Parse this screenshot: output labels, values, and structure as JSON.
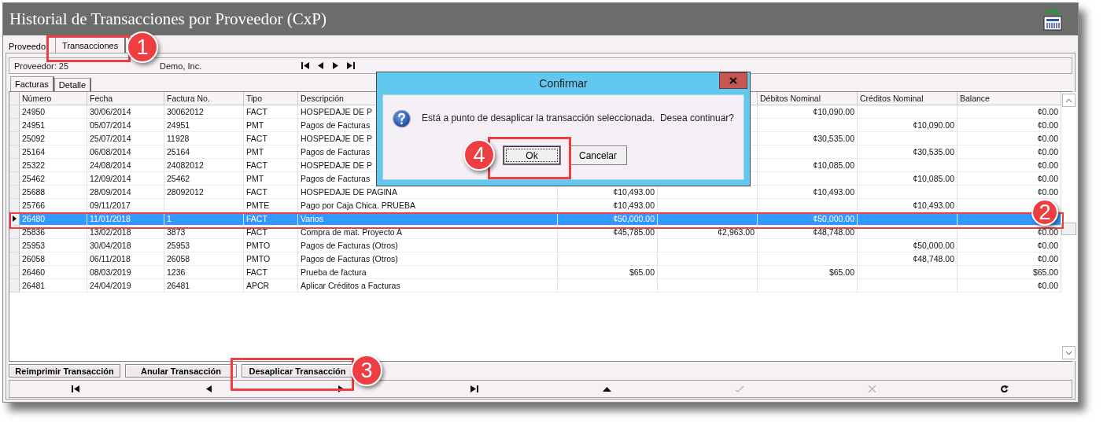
{
  "window": {
    "title": "Historial de Transacciones por Proveedor (CxP)"
  },
  "tabs": [
    {
      "label": "Proveedo",
      "selected": false
    },
    {
      "label": "Transacciones",
      "selected": true
    }
  ],
  "supplier": {
    "label": "Proveedor: 25",
    "name": "Demo, Inc."
  },
  "record_nav_top": [
    {
      "kind": "first"
    },
    {
      "kind": "prev"
    },
    {
      "kind": "next"
    },
    {
      "kind": "last"
    }
  ],
  "subtabs": [
    {
      "label": "Facturas",
      "selected": true
    },
    {
      "label": "Detalle",
      "selected": false
    }
  ],
  "table": {
    "columns": [
      {
        "label": "Número"
      },
      {
        "label": "Fecha"
      },
      {
        "label": "Factura No."
      },
      {
        "label": "Tipo"
      },
      {
        "label": "Descripción"
      },
      {},
      {},
      {
        "label": "Débitos Nominal"
      },
      {
        "label": "Créditos Nominal"
      },
      {
        "label": "Balance"
      }
    ],
    "rows": [
      {
        "selected": false,
        "cells": [
          "24950",
          "30/06/2014",
          "30062012",
          "FACT",
          "HOSPEDAJE DE P",
          null,
          null,
          "¢10,090.00",
          null,
          "¢0.00"
        ]
      },
      {
        "selected": false,
        "cells": [
          "24951",
          "05/07/2014",
          "24951",
          "PMT",
          "Pagos de Facturas",
          null,
          null,
          null,
          "¢10,090.00",
          "¢0.00"
        ]
      },
      {
        "selected": false,
        "cells": [
          "25092",
          "25/07/2014",
          "11928",
          "FACT",
          "HOSPEDAJE DE P",
          null,
          null,
          "¢30,535.00",
          null,
          "¢0.00"
        ]
      },
      {
        "selected": false,
        "cells": [
          "25164",
          "06/08/2014",
          "25164",
          "PMT",
          "Pagos de Facturas",
          null,
          null,
          null,
          "¢30,535.00",
          "¢0.00"
        ]
      },
      {
        "selected": false,
        "cells": [
          "25322",
          "24/08/2014",
          "24082012",
          "FACT",
          "HOSPEDAJE DE P",
          null,
          null,
          "¢10,085.00",
          null,
          "¢0.00"
        ]
      },
      {
        "selected": false,
        "cells": [
          "25462",
          "12/09/2014",
          "25462",
          "PMT",
          "Pagos de Facturas",
          null,
          null,
          null,
          "¢10,085.00",
          "¢0.00"
        ]
      },
      {
        "selected": false,
        "cells": [
          "25688",
          "28/09/2014",
          "28092012",
          "FACT",
          "HOSPEDAJE DE PAGINA",
          "¢10,493.00",
          null,
          "¢10,493.00",
          null,
          "¢0.00"
        ]
      },
      {
        "selected": false,
        "cells": [
          "25766",
          "09/11/2017",
          null,
          "PMTE",
          "Pago por Caja Chica. PRUEBA",
          "¢10,493.00",
          null,
          null,
          "¢10,493.00",
          null
        ]
      },
      {
        "selected": true,
        "cells": [
          "26480",
          "11/01/2018",
          "1",
          "FACT",
          "Varios",
          "¢50,000.00",
          null,
          "¢50,000.00",
          null,
          null
        ]
      },
      {
        "selected": false,
        "cells": [
          "25836",
          "13/02/2018",
          "3873",
          "FACT",
          "Compra de mat. Proyecto A",
          "¢45,785.00",
          "¢2,963.00",
          "¢48,748.00",
          null,
          "¢0.00"
        ]
      },
      {
        "selected": false,
        "cells": [
          "25953",
          "30/04/2018",
          "25953",
          "PMTO",
          "Pagos de Facturas (Otros)",
          null,
          null,
          null,
          "¢50,000.00",
          "¢0.00"
        ]
      },
      {
        "selected": false,
        "cells": [
          "26058",
          "06/11/2018",
          "26058",
          "PMTO",
          "Pagos de Facturas (Otros)",
          null,
          null,
          null,
          "¢48,748.00",
          "¢0.00"
        ]
      },
      {
        "selected": false,
        "cells": [
          "26460",
          "08/03/2019",
          "1236",
          "FACT",
          "Prueba de factura",
          "$65.00",
          null,
          "$65.00",
          null,
          "$65.00"
        ]
      },
      {
        "selected": false,
        "cells": [
          "26481",
          "24/04/2019",
          "26481",
          "APCR",
          "Aplicar Créditos a Facturas",
          null,
          null,
          null,
          null,
          "¢0.00"
        ]
      }
    ]
  },
  "actions": [
    "Reimprimir Transacción",
    "Anular Transacción",
    "Desaplicar Transacción"
  ],
  "record_nav": [
    {
      "kind": "first",
      "disabled": false
    },
    {
      "kind": "prev",
      "disabled": false
    },
    {
      "kind": "next",
      "disabled": false
    },
    {
      "kind": "last",
      "disabled": false
    },
    {
      "kind": "up",
      "disabled": false
    },
    {
      "kind": "confirm",
      "disabled": true
    },
    {
      "kind": "cancel",
      "disabled": true
    },
    {
      "kind": "refresh",
      "disabled": false
    }
  ],
  "dialog": {
    "title": "Confirmar",
    "message": "Está a punto de desaplicar la transacción seleccionada.  Desea continuar?",
    "buttons": [
      {
        "label": "Ok",
        "focused": true
      },
      {
        "label": "Cancelar",
        "focused": false
      }
    ]
  },
  "annotations": [
    {
      "number": "1"
    },
    {
      "number": "2"
    },
    {
      "number": "3"
    },
    {
      "number": "4"
    }
  ]
}
